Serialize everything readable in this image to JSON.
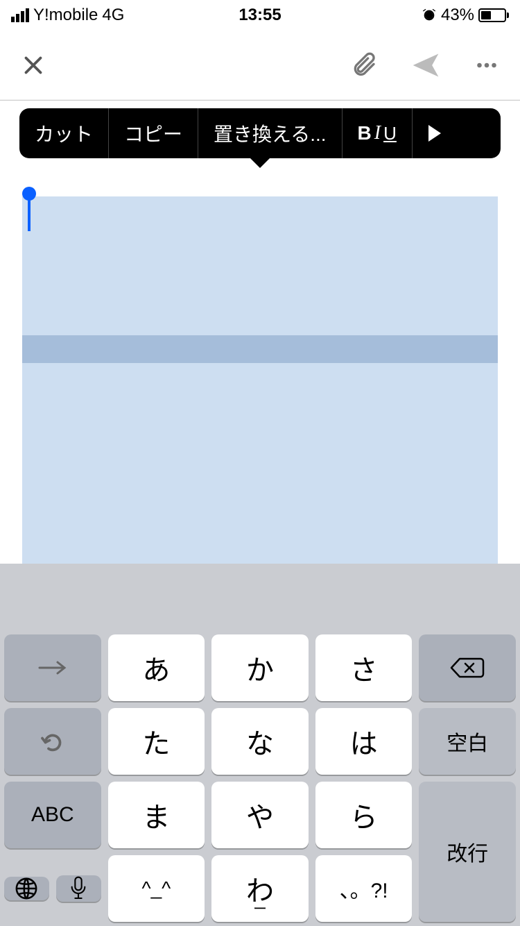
{
  "status": {
    "carrier": "Y!mobile",
    "network": "4G",
    "time": "13:55",
    "battery_pct": "43%"
  },
  "context_menu": {
    "cut": "カット",
    "copy": "コピー",
    "replace": "置き換える...",
    "biu_b": "B",
    "biu_i": "I",
    "biu_u": "U",
    "more": "▶"
  },
  "keyboard": {
    "arrow": "→",
    "a": "あ",
    "ka": "か",
    "sa": "さ",
    "undo": "↺",
    "ta": "た",
    "na": "な",
    "ha": "は",
    "space": "空白",
    "abc": "ABC",
    "ma": "ま",
    "ya": "や",
    "ra": "ら",
    "enter": "改行",
    "emoji": "^_^",
    "wa": "わ",
    "wa_sub": "ー",
    "punct": "、。?!"
  }
}
